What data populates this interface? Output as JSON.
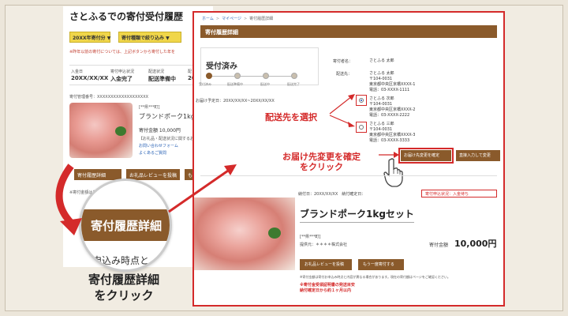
{
  "left_page": {
    "title": "さとふるでの寄付受付履歴",
    "filter_year": "20XX年寄付分",
    "filter_type": "寄付種類で絞り込み",
    "notice": "※昨年以前の寄付については、上記ボタンから寄付した年を",
    "status_cols": [
      {
        "label": "入金日",
        "value": "20XX/XX/XX"
      },
      {
        "label": "寄付申込状況",
        "value": "入金完了"
      },
      {
        "label": "配送状況",
        "value": "配送準備中"
      },
      {
        "label": "配",
        "value": "20"
      }
    ],
    "donation_no": "寄付管理番号：XXXXXXXXXXXXXXXXXXX",
    "shop": "[**県***町]",
    "product": "ブランドポーク1kgセット",
    "amount": "寄付金額 10,000円",
    "links": [
      "【お礼品・配送状況に関するお問",
      "お問い合わせフォーム",
      "よくあるご質問"
    ],
    "buttons": [
      "寄付履歴詳細",
      "お礼品レビューを投稿",
      "もう"
    ],
    "bottom_text": "※寄付金額はお申込み時点と内容が異なる"
  },
  "magnifier": {
    "button_label": "寄付履歴詳細",
    "under_text": "申込み時点と"
  },
  "captions": {
    "left": [
      "寄付履歴詳細",
      "をクリック"
    ],
    "select": "配送先を選択",
    "confirm": [
      "お届け先変更を確定",
      "をクリック"
    ]
  },
  "panel": {
    "breadcrumb": [
      "ホーム",
      "マイページ",
      "寄付履歴詳細"
    ],
    "header": "寄付履歴詳細",
    "status_title": "受付済み",
    "steps": [
      "受付済み",
      "配送準備中",
      "配送中",
      "配送完了"
    ],
    "delivery_date": "お届け予定日：20XX/XX/XX~20XX/XX/XX",
    "donor_label": "寄付者名：",
    "donor_name": "さとふる 太郎",
    "ship_label": "配送先：",
    "addresses": [
      [
        "さとふる 太郎",
        "〒104-0031",
        "東京都中央区京橋XXXX-1",
        "電話：03-XXXX-1111"
      ],
      [
        "さとふる 次郎",
        "〒104-0031",
        "東京都中央区京橋XXXX-2",
        "電話：03-XXXX-2222"
      ],
      [
        "さとふる 三郎",
        "〒104-0031",
        "東京都中央区京橋XXXX-3",
        "電話：03-XXXX-3333"
      ]
    ],
    "btn_confirm": "お届け先変更を確定",
    "btn_manual": "直接入力して変更",
    "order_label": "納付日：20XX/XX/XX　納付確定日：",
    "order_status": "寄付申込状況：入金待ち",
    "product": "ブランドポーク1kgセット",
    "shop": "[**県***町]",
    "provider": "提供元：＊＊＊＊株式会社",
    "amount_label": "寄付金額",
    "amount": "10,000円",
    "btn_review": "お礼品レビューを投稿",
    "btn_again": "もう一度寄付する",
    "note": "※寄付金額は寄付お申込み時点と内容が異なる場合があります。現在の寄付額はページをご確認ください。",
    "warn": [
      "※寄付金受領証明書の発送目安",
      "納付確定日から約１ヶ月以内"
    ]
  },
  "colors": {
    "accent_brown": "#8a5a2b",
    "highlight_red": "#d42a2a",
    "filter_yellow": "#f0d64a"
  }
}
